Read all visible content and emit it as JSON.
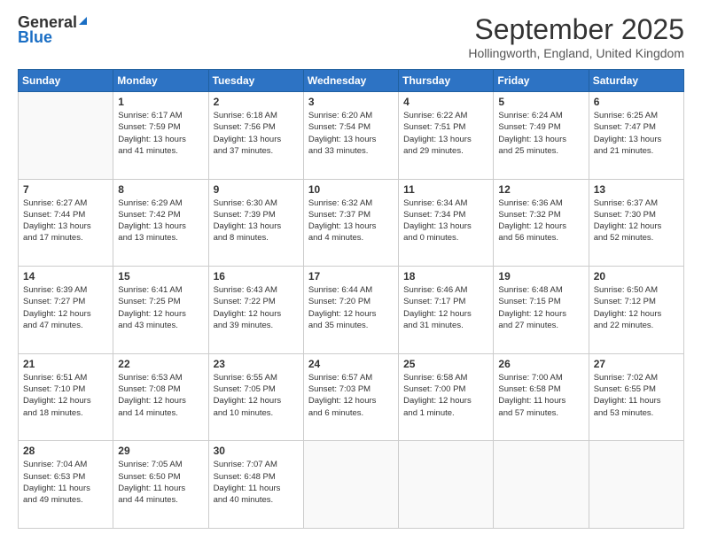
{
  "header": {
    "logo_line1": "General",
    "logo_line2": "Blue",
    "month_title": "September 2025",
    "location": "Hollingworth, England, United Kingdom"
  },
  "weekdays": [
    "Sunday",
    "Monday",
    "Tuesday",
    "Wednesday",
    "Thursday",
    "Friday",
    "Saturday"
  ],
  "weeks": [
    [
      {
        "day": "",
        "info": ""
      },
      {
        "day": "1",
        "info": "Sunrise: 6:17 AM\nSunset: 7:59 PM\nDaylight: 13 hours\nand 41 minutes."
      },
      {
        "day": "2",
        "info": "Sunrise: 6:18 AM\nSunset: 7:56 PM\nDaylight: 13 hours\nand 37 minutes."
      },
      {
        "day": "3",
        "info": "Sunrise: 6:20 AM\nSunset: 7:54 PM\nDaylight: 13 hours\nand 33 minutes."
      },
      {
        "day": "4",
        "info": "Sunrise: 6:22 AM\nSunset: 7:51 PM\nDaylight: 13 hours\nand 29 minutes."
      },
      {
        "day": "5",
        "info": "Sunrise: 6:24 AM\nSunset: 7:49 PM\nDaylight: 13 hours\nand 25 minutes."
      },
      {
        "day": "6",
        "info": "Sunrise: 6:25 AM\nSunset: 7:47 PM\nDaylight: 13 hours\nand 21 minutes."
      }
    ],
    [
      {
        "day": "7",
        "info": "Sunrise: 6:27 AM\nSunset: 7:44 PM\nDaylight: 13 hours\nand 17 minutes."
      },
      {
        "day": "8",
        "info": "Sunrise: 6:29 AM\nSunset: 7:42 PM\nDaylight: 13 hours\nand 13 minutes."
      },
      {
        "day": "9",
        "info": "Sunrise: 6:30 AM\nSunset: 7:39 PM\nDaylight: 13 hours\nand 8 minutes."
      },
      {
        "day": "10",
        "info": "Sunrise: 6:32 AM\nSunset: 7:37 PM\nDaylight: 13 hours\nand 4 minutes."
      },
      {
        "day": "11",
        "info": "Sunrise: 6:34 AM\nSunset: 7:34 PM\nDaylight: 13 hours\nand 0 minutes."
      },
      {
        "day": "12",
        "info": "Sunrise: 6:36 AM\nSunset: 7:32 PM\nDaylight: 12 hours\nand 56 minutes."
      },
      {
        "day": "13",
        "info": "Sunrise: 6:37 AM\nSunset: 7:30 PM\nDaylight: 12 hours\nand 52 minutes."
      }
    ],
    [
      {
        "day": "14",
        "info": "Sunrise: 6:39 AM\nSunset: 7:27 PM\nDaylight: 12 hours\nand 47 minutes."
      },
      {
        "day": "15",
        "info": "Sunrise: 6:41 AM\nSunset: 7:25 PM\nDaylight: 12 hours\nand 43 minutes."
      },
      {
        "day": "16",
        "info": "Sunrise: 6:43 AM\nSunset: 7:22 PM\nDaylight: 12 hours\nand 39 minutes."
      },
      {
        "day": "17",
        "info": "Sunrise: 6:44 AM\nSunset: 7:20 PM\nDaylight: 12 hours\nand 35 minutes."
      },
      {
        "day": "18",
        "info": "Sunrise: 6:46 AM\nSunset: 7:17 PM\nDaylight: 12 hours\nand 31 minutes."
      },
      {
        "day": "19",
        "info": "Sunrise: 6:48 AM\nSunset: 7:15 PM\nDaylight: 12 hours\nand 27 minutes."
      },
      {
        "day": "20",
        "info": "Sunrise: 6:50 AM\nSunset: 7:12 PM\nDaylight: 12 hours\nand 22 minutes."
      }
    ],
    [
      {
        "day": "21",
        "info": "Sunrise: 6:51 AM\nSunset: 7:10 PM\nDaylight: 12 hours\nand 18 minutes."
      },
      {
        "day": "22",
        "info": "Sunrise: 6:53 AM\nSunset: 7:08 PM\nDaylight: 12 hours\nand 14 minutes."
      },
      {
        "day": "23",
        "info": "Sunrise: 6:55 AM\nSunset: 7:05 PM\nDaylight: 12 hours\nand 10 minutes."
      },
      {
        "day": "24",
        "info": "Sunrise: 6:57 AM\nSunset: 7:03 PM\nDaylight: 12 hours\nand 6 minutes."
      },
      {
        "day": "25",
        "info": "Sunrise: 6:58 AM\nSunset: 7:00 PM\nDaylight: 12 hours\nand 1 minute."
      },
      {
        "day": "26",
        "info": "Sunrise: 7:00 AM\nSunset: 6:58 PM\nDaylight: 11 hours\nand 57 minutes."
      },
      {
        "day": "27",
        "info": "Sunrise: 7:02 AM\nSunset: 6:55 PM\nDaylight: 11 hours\nand 53 minutes."
      }
    ],
    [
      {
        "day": "28",
        "info": "Sunrise: 7:04 AM\nSunset: 6:53 PM\nDaylight: 11 hours\nand 49 minutes."
      },
      {
        "day": "29",
        "info": "Sunrise: 7:05 AM\nSunset: 6:50 PM\nDaylight: 11 hours\nand 44 minutes."
      },
      {
        "day": "30",
        "info": "Sunrise: 7:07 AM\nSunset: 6:48 PM\nDaylight: 11 hours\nand 40 minutes."
      },
      {
        "day": "",
        "info": ""
      },
      {
        "day": "",
        "info": ""
      },
      {
        "day": "",
        "info": ""
      },
      {
        "day": "",
        "info": ""
      }
    ]
  ]
}
